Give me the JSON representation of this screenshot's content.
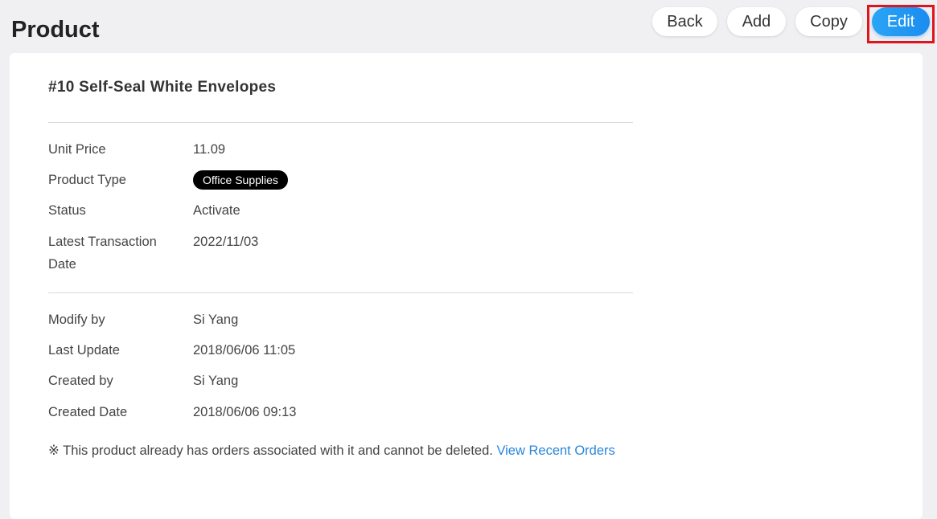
{
  "header": {
    "title": "Product"
  },
  "toolbar": {
    "back_label": "Back",
    "add_label": "Add",
    "copy_label": "Copy",
    "edit_label": "Edit"
  },
  "product": {
    "name": "#10 Self-Seal White Envelopes",
    "fields": {
      "unit_price_label": "Unit Price",
      "unit_price_value": "11.09",
      "product_type_label": "Product Type",
      "product_type_value": "Office Supplies",
      "status_label": "Status",
      "status_value": "Activate",
      "latest_transaction_label": "Latest Transaction Date",
      "latest_transaction_value": "2022/11/03"
    },
    "audit": {
      "modify_by_label": "Modify by",
      "modify_by_value": "Si Yang",
      "last_update_label": "Last Update",
      "last_update_value": "2018/06/06 11:05",
      "created_by_label": "Created by",
      "created_by_value": "Si Yang",
      "created_date_label": "Created Date",
      "created_date_value": "2018/06/06 09:13"
    },
    "notice": {
      "text": "※ This product already has orders associated with it and cannot be deleted. ",
      "link_label": "View Recent Orders"
    }
  },
  "colors": {
    "background": "#f0f0f2",
    "card": "#ffffff",
    "accent": "#1a8cf0",
    "link": "#2b86db",
    "badge": "#000000",
    "highlight": "#e0141e"
  }
}
